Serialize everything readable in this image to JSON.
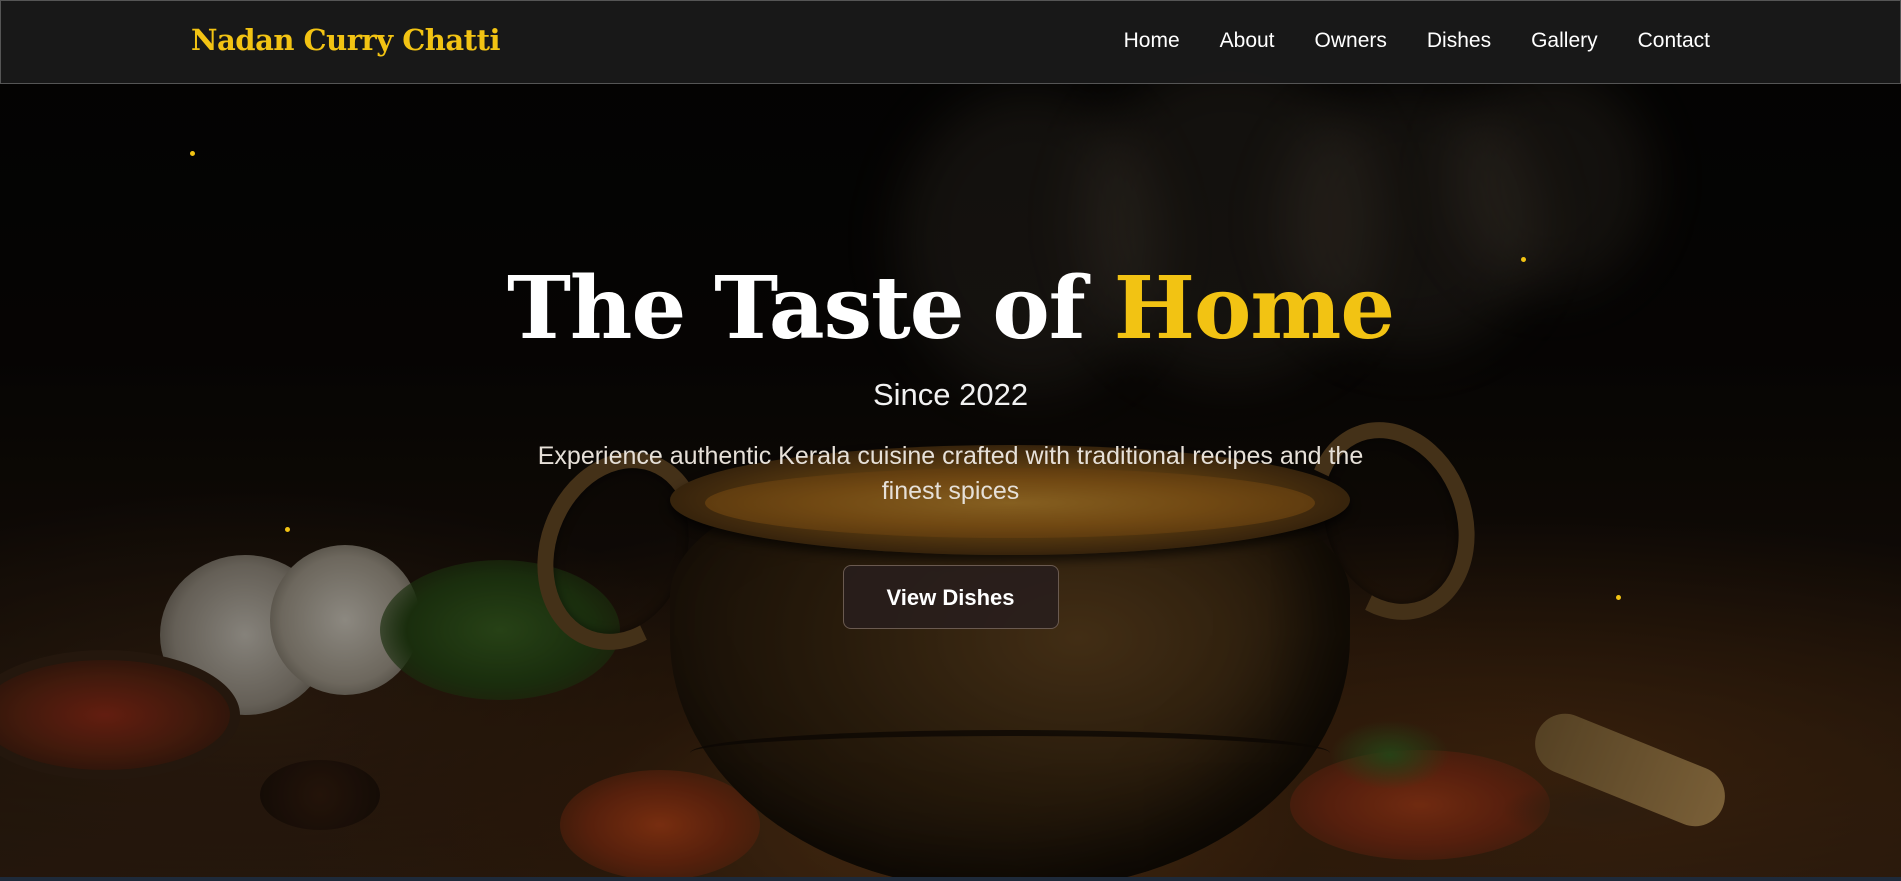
{
  "brand": "Nadan Curry Chatti",
  "nav": {
    "items": [
      {
        "label": "Home"
      },
      {
        "label": "About"
      },
      {
        "label": "Owners"
      },
      {
        "label": "Dishes"
      },
      {
        "label": "Gallery"
      },
      {
        "label": "Contact"
      }
    ]
  },
  "hero": {
    "title_main": "The Taste of ",
    "title_accent": "Home",
    "since": "Since 2022",
    "tagline": "Experience authentic Kerala cuisine crafted with traditional recipes and the finest spices",
    "cta_label": "View Dishes"
  },
  "colors": {
    "accent": "#f2c313",
    "navbar": "#1a1a1a",
    "text": "#ffffff"
  }
}
